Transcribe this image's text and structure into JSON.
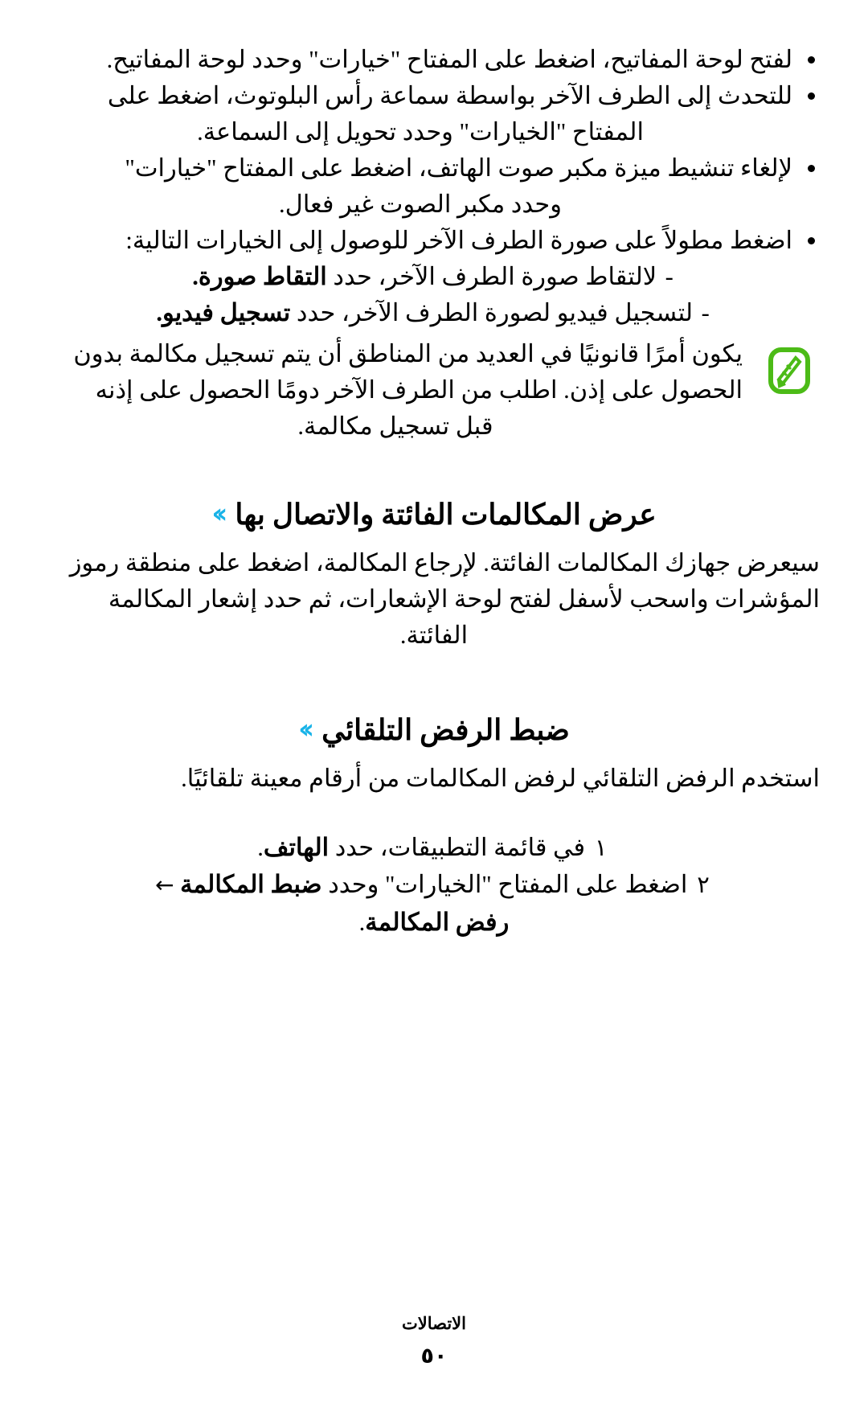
{
  "document": {
    "language": "ar",
    "direction": "rtl",
    "accent_color": "#19b3e8",
    "note_icon_color": "#4cbb17"
  },
  "bullets": [
    {
      "line1": "لفتح لوحة المفاتيح، اضغط على المفتاح \"خيارات\" وحدد لوحة المفاتيح."
    },
    {
      "line1": "للتحدث إلى الطرف الآخر بواسطة سماعة رأس البلوتوث، اضغط على",
      "line2": "المفتاح \"الخيارات\" وحدد تحويل إلى السماعة."
    },
    {
      "line1": "لإلغاء تنشيط ميزة مكبر صوت الهاتف، اضغط على المفتاح \"خيارات\"",
      "line2": "وحدد مكبر الصوت غير فعال."
    },
    {
      "line1": "اضغط مطولاً على صورة الطرف الآخر للوصول إلى الخيارات التالية:"
    }
  ],
  "bullet_bold": {
    "b1": "لوحة المفاتيح.",
    "b2": "تحويل إلى السماعة.",
    "b3": "مكبر الصوت غير فعال."
  },
  "sub_items": [
    {
      "dash": "-",
      "text": "لالتقاط صورة الطرف الآخر، حدد",
      "bold": "التقاط صورة."
    },
    {
      "dash": "-",
      "text": "لتسجيل فيديو لصورة الطرف الآخر، حدد",
      "bold": "تسجيل فيديو."
    }
  ],
  "note": {
    "icon_name": "note-pencil-icon",
    "line1": "يكون أمرًا قانونيًا في العديد من المناطق أن يتم تسجيل مكالمة بدون",
    "line2": "الحصول على إذن. اطلب من الطرف الآخر دومًا الحصول على إذنه",
    "line3": "قبل تسجيل مكالمة."
  },
  "sections": [
    {
      "chevron": "››",
      "heading": "عرض المكالمات الفائتة والاتصال بها",
      "paragraph_line1": "سيعرض جهازك المكالمات الفائتة. لإرجاع المكالمة، اضغط على منطقة",
      "paragraph_line2": "رموز المؤشرات واسحب لأسفل لفتح لوحة الإشعارات، ثم حدد إشعار المكالمة",
      "paragraph_line3": "الفائتة."
    },
    {
      "chevron": "››",
      "heading": "ضبط الرفض التلقائي",
      "paragraph_line1": "استخدم الرفض التلقائي لرفض المكالمات من أرقام معينة تلقائيًا.",
      "steps": [
        {
          "number": "١",
          "text": "في قائمة التطبيقات، حدد",
          "bold": "الهاتف",
          "suffix": "."
        },
        {
          "number": "٢",
          "text": "اضغط على المفتاح \"الخيارات\" وحدد",
          "bold": "ضبط المكالمة",
          "arrow": "←",
          "continuation_bold": "رفض المكالمة",
          "continuation_suffix": "."
        }
      ]
    }
  ],
  "footer": {
    "title": "الاتصالات",
    "page_number": "٥٠"
  }
}
